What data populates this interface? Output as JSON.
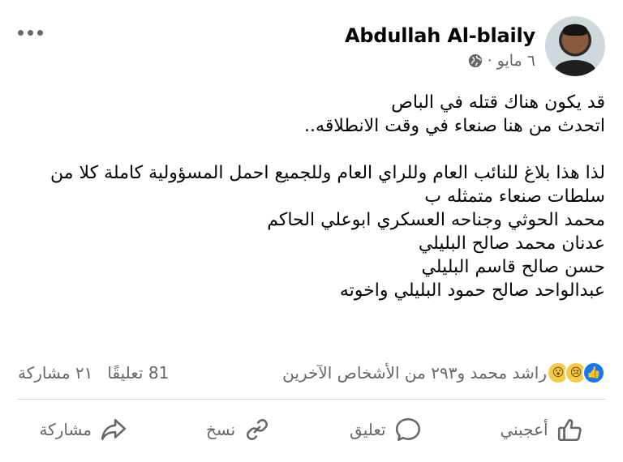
{
  "post": {
    "author": "Abdullah Al-blaily",
    "date": "٦ مايو ·",
    "body": {
      "line1": "قد يكون هناك قتله في الباص",
      "line2": "اتحدث من هنا صنعاء في وقت الانطلاقه..",
      "line3": "لذا هذا بلاغ للنائب العام وللراي العام وللجميع احمل المسؤولية كاملة كلا من",
      "line4": "سلطات صنعاء متمثله ب",
      "line5": "محمد الحوثي وجناحه العسكري ابوعلي الحاكم",
      "line6": "عدنان محمد صالح البليلي",
      "line7": "حسن صالح قاسم البليلي",
      "line8": "عبدالواحد صالح حمود البليلي واخوته"
    }
  },
  "stats": {
    "reactors": "راشد محمد و٢٩٣ من الأشخاص الآخرين",
    "comments": "81 تعليقًا",
    "shares": "٢١ مشاركة"
  },
  "actions": {
    "like": "أعجبني",
    "comment": "تعليق",
    "copy": "نسخ",
    "share": "مشاركة"
  },
  "icons": {
    "more": "more-options-icon",
    "privacy": "globe-icon",
    "like_reaction": "like-reaction-icon",
    "sad_reaction": "sad-reaction-icon",
    "wow_reaction": "wow-reaction-icon"
  },
  "colors": {
    "text": "#050505",
    "muted": "#65676b",
    "like_blue": "#1877f2",
    "emoji_yellow": "#f7c948"
  }
}
